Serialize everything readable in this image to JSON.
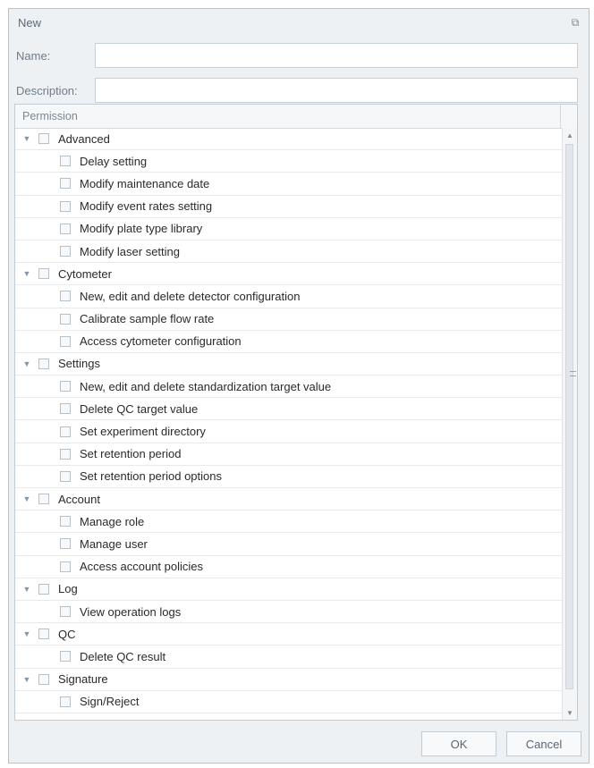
{
  "window": {
    "title": "New",
    "restore_icon": "restore-icon"
  },
  "form": {
    "name_label": "Name:",
    "name_value": "",
    "description_label": "Description:",
    "description_value": ""
  },
  "permissions": {
    "header": "Permission",
    "groups": [
      {
        "label": "Advanced",
        "children": [
          "Delay setting",
          "Modify maintenance date",
          "Modify event rates setting",
          "Modify plate type library",
          "Modify laser setting"
        ]
      },
      {
        "label": "Cytometer",
        "children": [
          "New, edit and delete detector configuration",
          "Calibrate sample flow rate",
          "Access cytometer configuration"
        ]
      },
      {
        "label": "Settings",
        "children": [
          "New, edit and delete standardization target value",
          "Delete QC target value",
          "Set experiment directory",
          "Set retention period",
          "Set retention period options"
        ]
      },
      {
        "label": "Account",
        "children": [
          "Manage role",
          "Manage user",
          "Access account policies"
        ]
      },
      {
        "label": "Log",
        "children": [
          "View operation logs"
        ]
      },
      {
        "label": "QC",
        "children": [
          "Delete QC result"
        ]
      },
      {
        "label": "Signature",
        "children": [
          "Sign/Reject"
        ]
      }
    ]
  },
  "buttons": {
    "ok": "OK",
    "cancel": "Cancel"
  }
}
